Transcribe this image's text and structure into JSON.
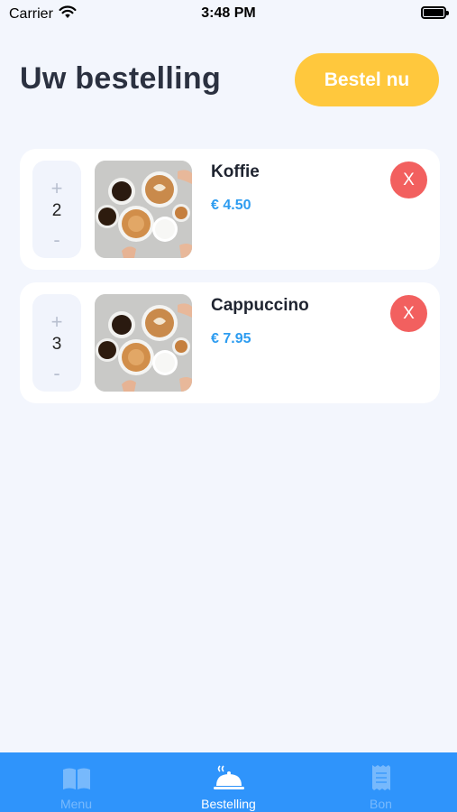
{
  "status_bar": {
    "carrier": "Carrier",
    "time": "3:48 PM"
  },
  "header": {
    "title": "Uw bestelling",
    "order_button_label": "Bestel nu"
  },
  "order_items": [
    {
      "name": "Koffie",
      "price": "€ 4.50",
      "quantity": "2",
      "plus_label": "+",
      "minus_label": "-",
      "remove_label": "X"
    },
    {
      "name": "Cappuccino",
      "price": "€ 7.95",
      "quantity": "3",
      "plus_label": "+",
      "minus_label": "-",
      "remove_label": "X"
    }
  ],
  "tab_bar": {
    "active_tab": "Bestelling",
    "tabs": [
      {
        "label": "Menu",
        "icon": "book-icon"
      },
      {
        "label": "Bestelling",
        "icon": "serving-cloche-icon"
      },
      {
        "label": "Bon",
        "icon": "receipt-icon"
      }
    ]
  },
  "colors": {
    "accent_yellow": "#ffc83d",
    "price_blue": "#2d9cf0",
    "remove_red": "#f2605f",
    "tab_bar_blue": "#2f94fb",
    "background": "#f3f6fd"
  }
}
